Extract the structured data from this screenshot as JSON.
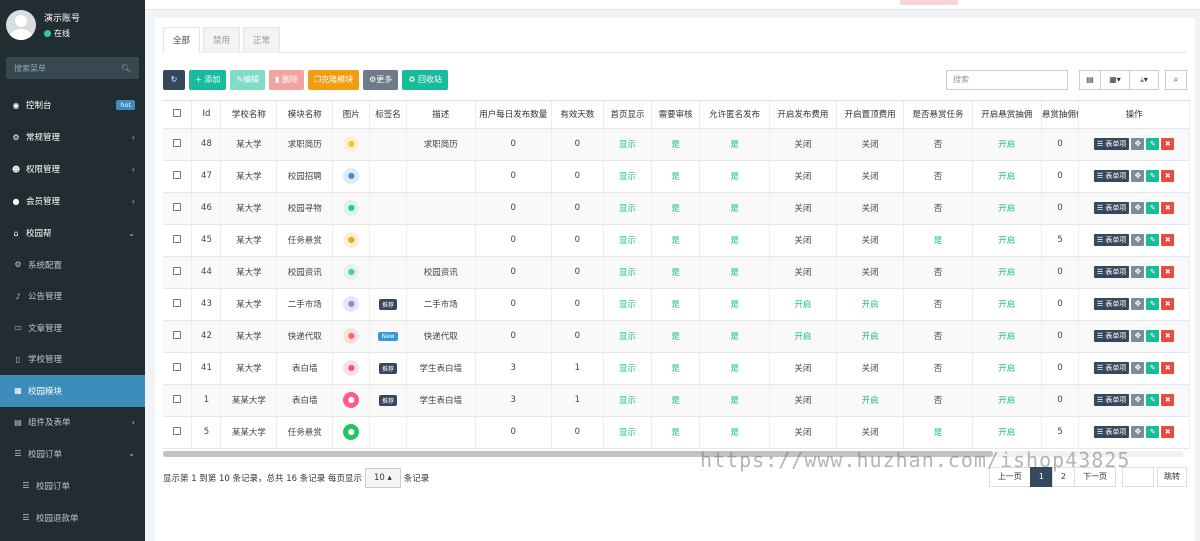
{
  "user": {
    "name": "演示账号",
    "status": "在线"
  },
  "sidebar": {
    "search_placeholder": "搜索菜单",
    "items": [
      {
        "label": "控制台",
        "icon": "dashboard-icon",
        "badge": "hot"
      },
      {
        "label": "常规管理",
        "icon": "cogs-icon"
      },
      {
        "label": "权限管理",
        "icon": "group-icon"
      },
      {
        "label": "会员管理",
        "icon": "user-icon"
      },
      {
        "label": "校园帮",
        "icon": "university-icon"
      },
      {
        "label": "系统配置",
        "icon": "gears-icon"
      },
      {
        "label": "公告管理",
        "icon": "bell-icon"
      },
      {
        "label": "文章管理",
        "icon": "article-icon"
      },
      {
        "label": "学校管理",
        "icon": "book-icon"
      },
      {
        "label": "校园模块",
        "icon": "grid-icon"
      },
      {
        "label": "组件及表单",
        "icon": "form-icon"
      },
      {
        "label": "校园订单",
        "icon": "list-icon"
      },
      {
        "label": "校园订单",
        "icon": "list-icon"
      },
      {
        "label": "校园退款单",
        "icon": "list-icon"
      }
    ]
  },
  "tabs": [
    "全部",
    "禁用",
    "正常"
  ],
  "toolbar": {
    "add": "添加",
    "edit": "编辑",
    "delete": "删除",
    "clone": "克隆模块",
    "more": "更多",
    "recycle": "回收站"
  },
  "search": {
    "placeholder": "搜索"
  },
  "columns": [
    "Id",
    "学校名称",
    "模块名称",
    "图片",
    "标签名",
    "描述",
    "用户每日发布数量",
    "有效天数",
    "首页显示",
    "需要审核",
    "允许匿名发布",
    "开启发布费用",
    "开启置顶费用",
    "是否悬赏任务",
    "开启悬赏抽佣",
    "悬赏抽佣值",
    "操作"
  ],
  "rows": [
    {
      "id": "48",
      "school": "某大学",
      "module": "求职简历",
      "tag": "",
      "desc": "求职简历",
      "daily": "0",
      "days": "0",
      "home": "显示",
      "audit": "是",
      "anon": "是",
      "pubfee": "关闭",
      "topfee": "关闭",
      "reward": "否",
      "commission": "开启",
      "commval": "0",
      "pic_color": "#f5c242",
      "pic_bg": "#fdf0d0"
    },
    {
      "id": "47",
      "school": "某大学",
      "module": "校园招聘",
      "tag": "",
      "desc": "",
      "daily": "0",
      "days": "0",
      "home": "显示",
      "audit": "是",
      "anon": "是",
      "pubfee": "关闭",
      "topfee": "关闭",
      "reward": "否",
      "commission": "开启",
      "commval": "0",
      "pic_color": "#3b8fe0",
      "pic_bg": "#dcebfa"
    },
    {
      "id": "46",
      "school": "某大学",
      "module": "校园寻物",
      "tag": "",
      "desc": "",
      "daily": "0",
      "days": "0",
      "home": "显示",
      "audit": "是",
      "anon": "是",
      "pubfee": "关闭",
      "topfee": "关闭",
      "reward": "否",
      "commission": "开启",
      "commval": "0",
      "pic_color": "#2ecc71",
      "pic_bg": "#dcf5e6"
    },
    {
      "id": "45",
      "school": "某大学",
      "module": "任务悬赏",
      "tag": "",
      "desc": "",
      "daily": "0",
      "days": "0",
      "home": "显示",
      "audit": "是",
      "anon": "是",
      "pubfee": "关闭",
      "topfee": "关闭",
      "reward": "是",
      "commission": "开启",
      "commval": "5",
      "pic_color": "#f0a030",
      "pic_bg": "#fdeed6"
    },
    {
      "id": "44",
      "school": "某大学",
      "module": "校园资讯",
      "tag": "",
      "desc": "校园资讯",
      "daily": "0",
      "days": "0",
      "home": "显示",
      "audit": "是",
      "anon": "是",
      "pubfee": "关闭",
      "topfee": "关闭",
      "reward": "否",
      "commission": "开启",
      "commval": "0",
      "pic_color": "#4cd07d",
      "pic_bg": "#dff6e8"
    },
    {
      "id": "43",
      "school": "某大学",
      "module": "二手市场",
      "tag": "推荐",
      "desc": "二手市场",
      "daily": "0",
      "days": "0",
      "home": "显示",
      "audit": "是",
      "anon": "是",
      "pubfee": "开启",
      "topfee": "开启",
      "reward": "否",
      "commission": "开启",
      "commval": "0",
      "pic_color": "#a67be8",
      "pic_bg": "#ece2fa"
    },
    {
      "id": "42",
      "school": "某大学",
      "module": "快递代取",
      "tag": "New",
      "desc": "快递代取",
      "daily": "0",
      "days": "0",
      "home": "显示",
      "audit": "是",
      "anon": "是",
      "pubfee": "开启",
      "topfee": "开启",
      "reward": "否",
      "commission": "开启",
      "commval": "0",
      "pic_color": "#ef6b6b",
      "pic_bg": "#fbe0e0"
    },
    {
      "id": "41",
      "school": "某大学",
      "module": "表白墙",
      "tag": "推荐",
      "desc": "学生表白墙",
      "daily": "3",
      "days": "1",
      "home": "显示",
      "audit": "是",
      "anon": "是",
      "pubfee": "关闭",
      "topfee": "关闭",
      "reward": "否",
      "commission": "开启",
      "commval": "0",
      "pic_color": "#e85a7a",
      "pic_bg": "#fbdfe6"
    },
    {
      "id": "1",
      "school": "某某大学",
      "module": "表白墙",
      "tag": "推荐",
      "desc": "学生表白墙",
      "daily": "3",
      "days": "1",
      "home": "显示",
      "audit": "是",
      "anon": "是",
      "pubfee": "关闭",
      "topfee": "开启",
      "reward": "否",
      "commission": "开启",
      "commval": "0",
      "pic_color": "#ff5a8a",
      "pic_bg": "#ff5a8a"
    },
    {
      "id": "5",
      "school": "某某大学",
      "module": "任务悬赏",
      "tag": "",
      "desc": "",
      "daily": "0",
      "days": "0",
      "home": "显示",
      "audit": "是",
      "anon": "是",
      "pubfee": "关闭",
      "topfee": "关闭",
      "reward": "是",
      "commission": "开启",
      "commval": "5",
      "pic_color": "#22c55e",
      "pic_bg": "#22c55e"
    }
  ],
  "op_form_label": "表单项",
  "footer": {
    "info_prefix": "显示第 1 到第 10 条记录，总共 16 条记录 每页显示",
    "page_size": "10",
    "info_suffix": "条记录"
  },
  "pager": {
    "prev": "上一页",
    "p1": "1",
    "p2": "2",
    "next": "下一页",
    "jump": "跳转"
  },
  "watermark": "https://www.huzhan.com/ishop43825"
}
